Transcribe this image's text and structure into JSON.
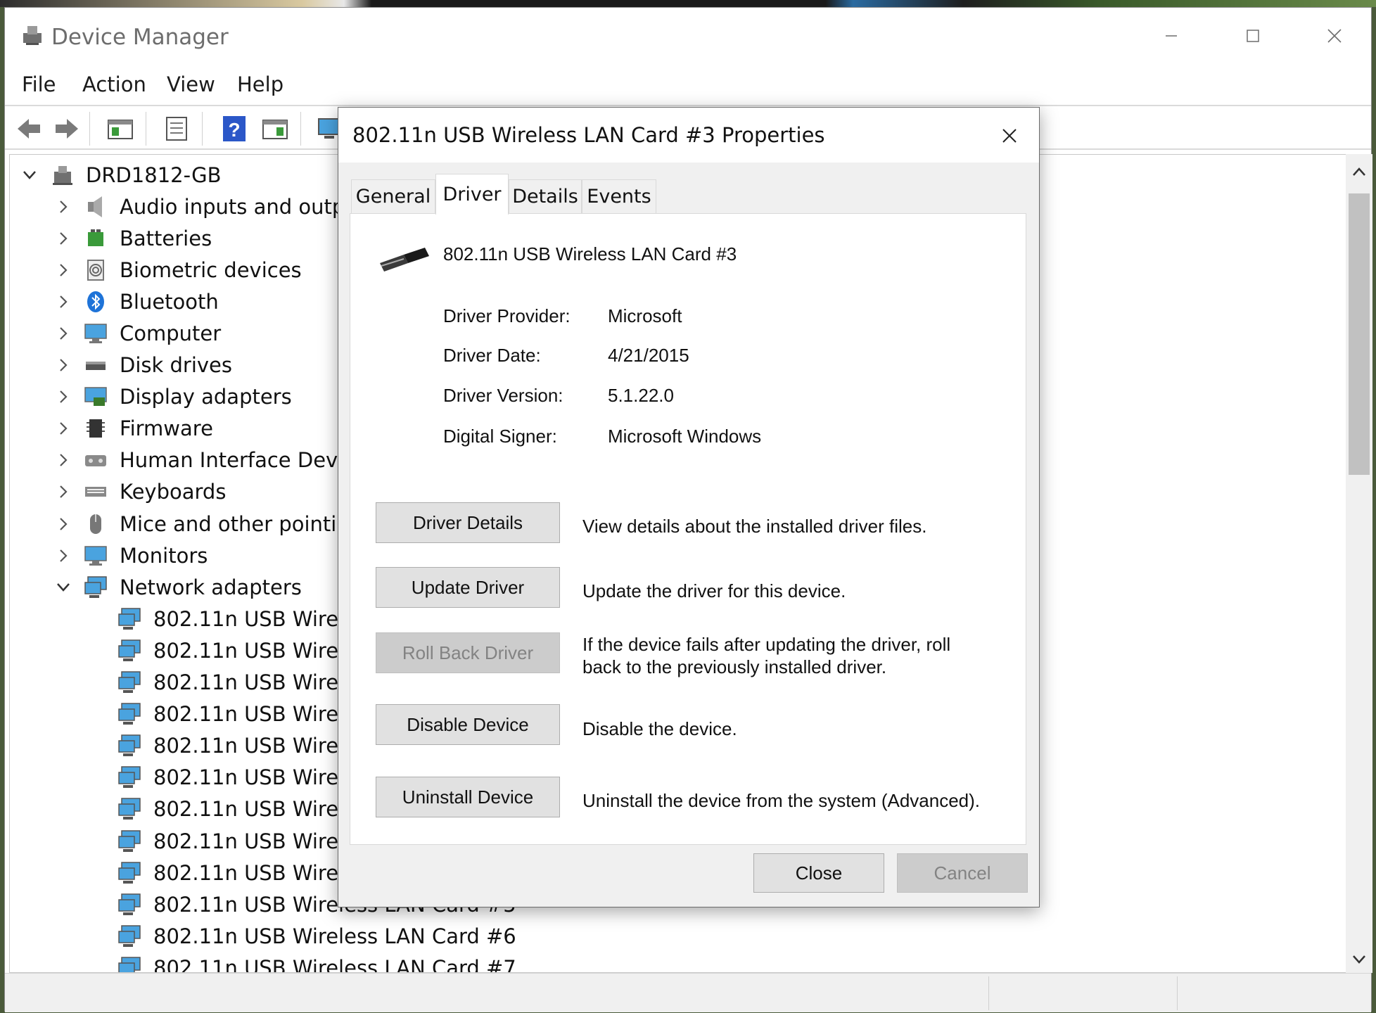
{
  "window": {
    "title": "Device Manager"
  },
  "menu": {
    "file": "File",
    "action": "Action",
    "view": "View",
    "help": "Help"
  },
  "tree": {
    "root": "DRD1812-GB",
    "categories": [
      "Audio inputs and outputs",
      "Batteries",
      "Biometric devices",
      "Bluetooth",
      "Computer",
      "Disk drives",
      "Display adapters",
      "Firmware",
      "Human Interface Devices",
      "Keyboards",
      "Mice and other pointing devices",
      "Monitors",
      "Network adapters"
    ],
    "network_children": [
      "802.11n USB Wireless LAN Card",
      "802.11n USB Wireless LAN Card",
      "802.11n USB Wireless LAN Card",
      "802.11n USB Wireless LAN Card",
      "802.11n USB Wireless LAN Card",
      "802.11n USB Wireless LAN Card",
      "802.11n USB Wireless LAN Card",
      "802.11n USB Wireless LAN Card",
      "802.11n USB Wireless LAN Card",
      "802.11n USB Wireless LAN Card #5",
      "802.11n USB Wireless LAN Card #6",
      "802.11n USB Wireless LAN Card #7"
    ]
  },
  "dialog": {
    "title": "802.11n USB Wireless LAN Card #3 Properties",
    "tabs": {
      "general": "General",
      "driver": "Driver",
      "details": "Details",
      "events": "Events"
    },
    "device_name": "802.11n USB Wireless LAN Card #3",
    "info": {
      "provider_label": "Driver Provider:",
      "provider_value": "Microsoft",
      "date_label": "Driver Date:",
      "date_value": "4/21/2015",
      "version_label": "Driver Version:",
      "version_value": "5.1.22.0",
      "signer_label": "Digital Signer:",
      "signer_value": "Microsoft Windows"
    },
    "actions": {
      "details_btn": "Driver Details",
      "details_desc": "View details about the installed driver files.",
      "update_btn": "Update Driver",
      "update_desc": "Update the driver for this device.",
      "rollback_btn": "Roll Back Driver",
      "rollback_desc": "If the device fails after updating the driver, roll back to the previously installed driver.",
      "disable_btn": "Disable Device",
      "disable_desc": "Disable the device.",
      "uninstall_btn": "Uninstall Device",
      "uninstall_desc": "Uninstall the device from the system (Advanced)."
    },
    "footer": {
      "close": "Close",
      "cancel": "Cancel"
    }
  },
  "colors": {
    "accent": "#0078d7",
    "disabled_text": "#838383",
    "button_face": "#e1e1e1"
  }
}
